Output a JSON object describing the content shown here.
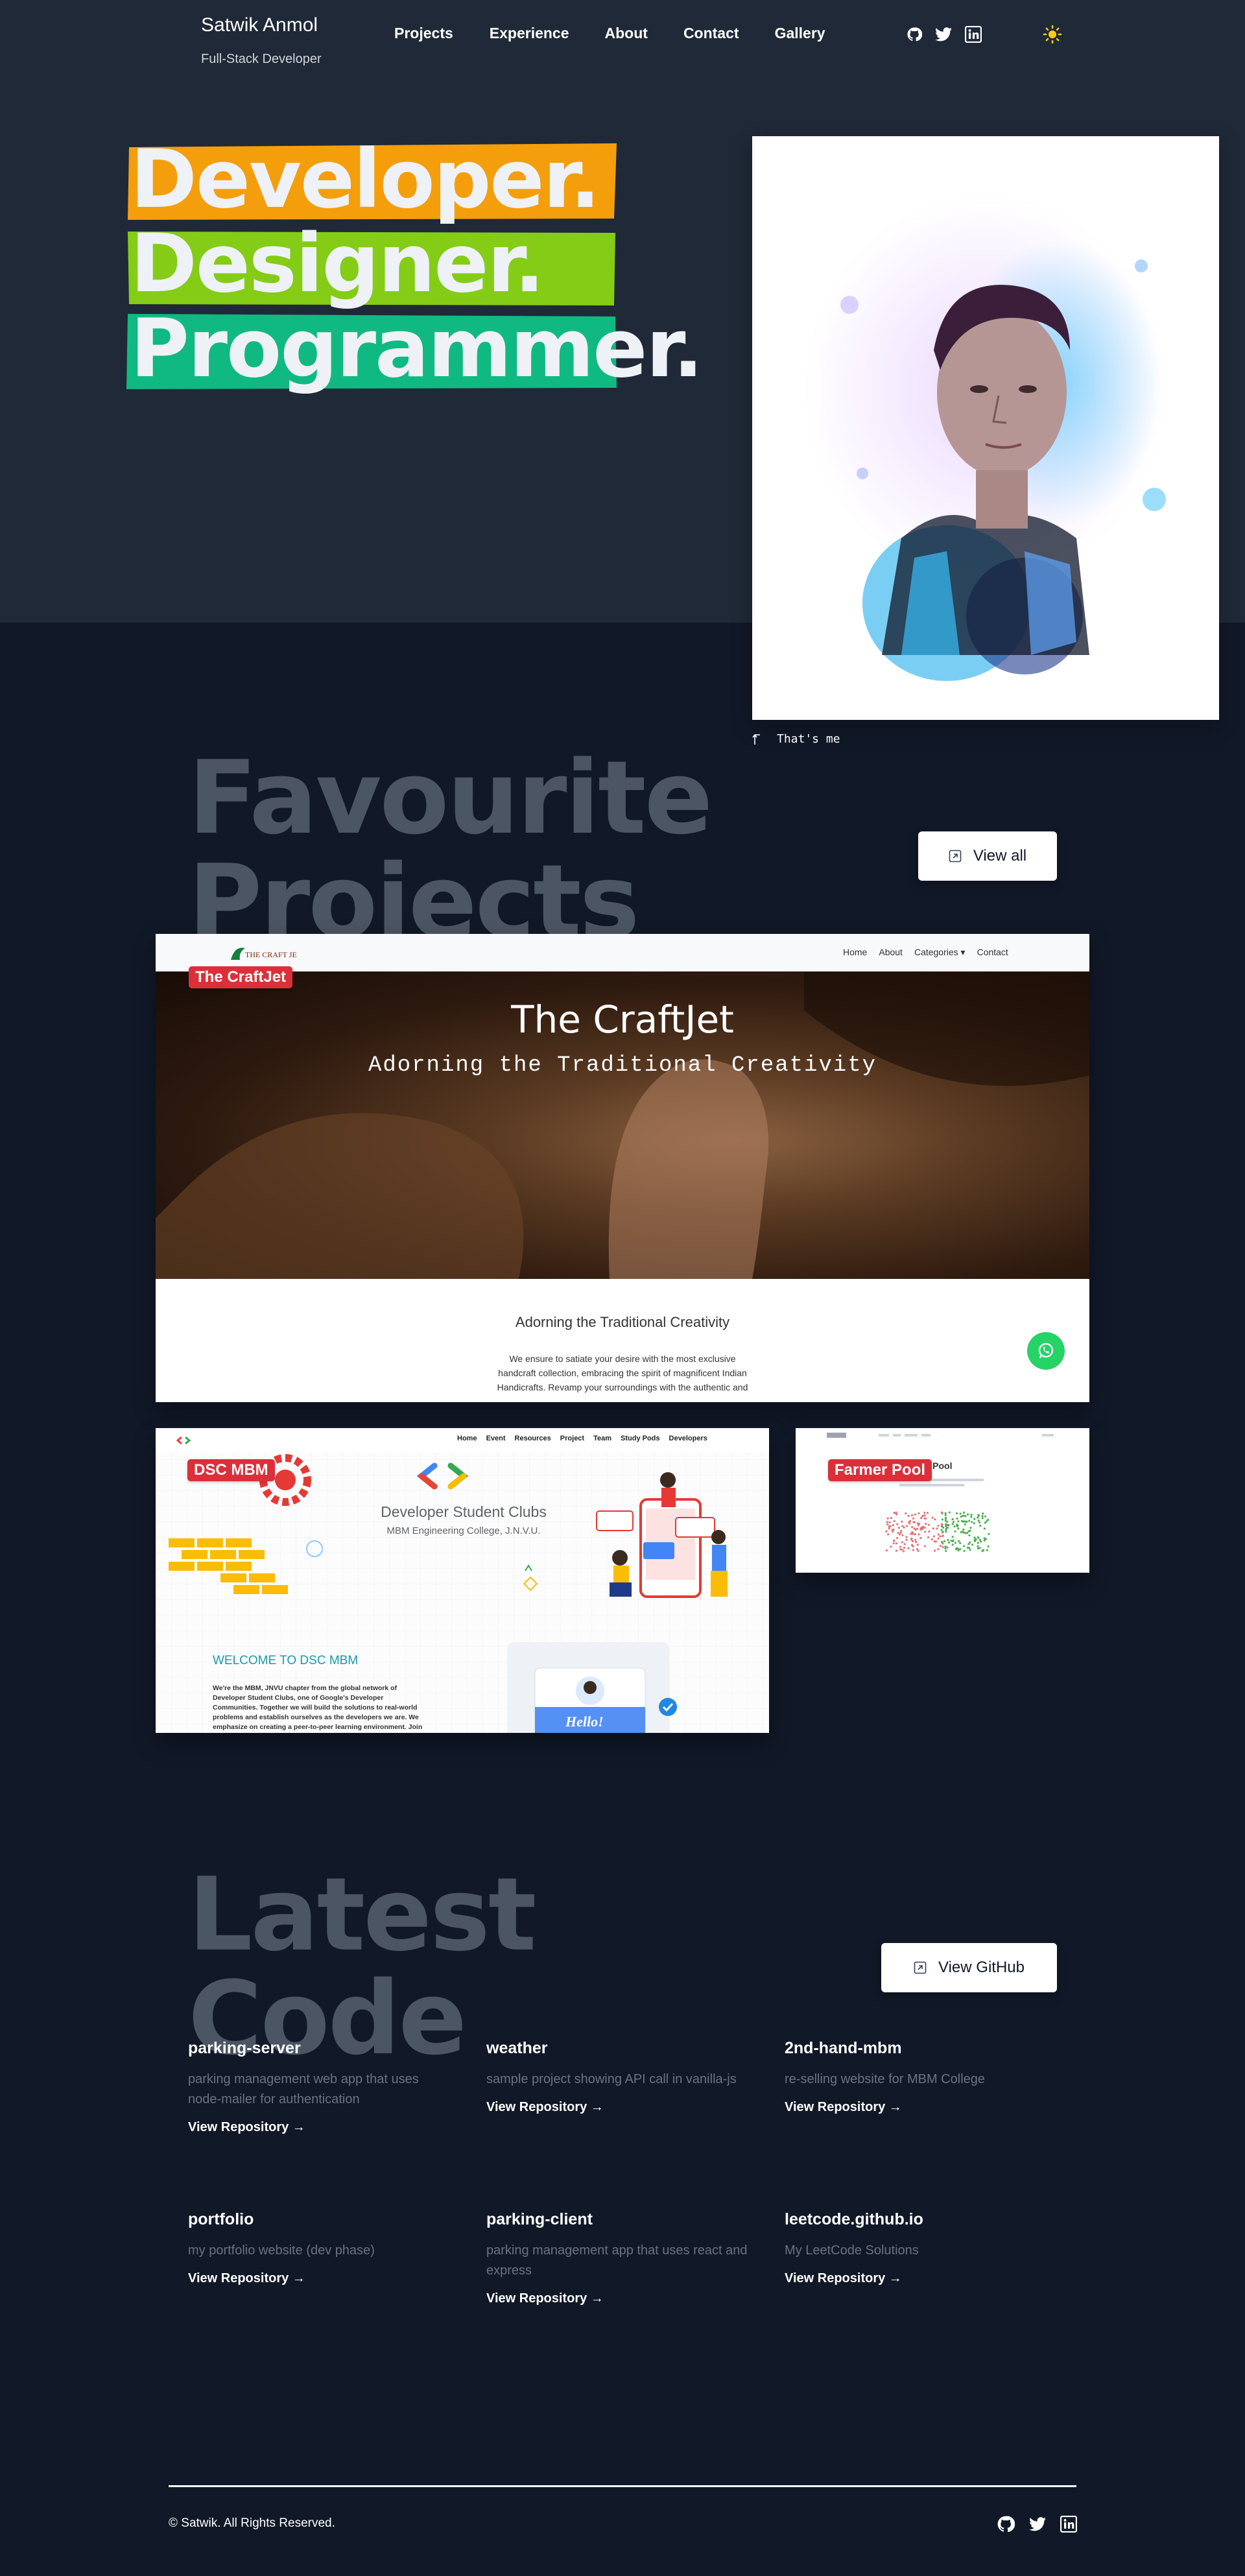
{
  "header": {
    "name": "Satwik Anmol",
    "role": "Full-Stack Developer",
    "nav": [
      "Projects",
      "Experience",
      "About",
      "Contact",
      "Gallery"
    ],
    "social_icons": [
      "github-icon",
      "twitter-icon",
      "linkedin-icon"
    ],
    "theme_icon": "sun-icon"
  },
  "hero": {
    "words": [
      "Developer.",
      "Designer.",
      "Programmer."
    ],
    "word_colors": [
      "#f59e0b",
      "#84cc16",
      "#10b981"
    ],
    "caption": "That's me"
  },
  "projects": {
    "title_line1": "Favourite",
    "title_line2": "Projects",
    "view_all_label": "View all",
    "craftjet": {
      "badge": "The CraftJet",
      "logo_text": "THE CRAFT JET",
      "nav": [
        "Home",
        "About",
        "Categories",
        "Contact"
      ],
      "hero_title": "The CraftJet",
      "hero_subtitle": "Adorning the Traditional Creativity",
      "section_heading": "Adorning the Traditional Creativity",
      "section_text_1": "We ensure to satiate your desire with the most exclusive",
      "section_text_2": "handcraft collection, embracing the spirit of magnificent Indian",
      "section_text_3": "Handicrafts. Revamp your surroundings with the authentic and"
    },
    "dsc": {
      "badge": "DSC MBM",
      "nav": [
        "Home",
        "Event",
        "Resources",
        "Project",
        "Team",
        "Study Pods",
        "Developers"
      ],
      "title": "Developer Student Clubs",
      "subtitle": "MBM Engineering College, J.N.V.U.",
      "welcome": "WELCOME TO DSC MBM",
      "para_1": "We're the MBM, JNVU chapter from the global network of",
      "para_2": "Developer Student Clubs, one of Google's Developer",
      "para_3": "Communities. Together we will build the solutions to real-world",
      "para_4": "problems and establish ourselves as the developers we are. We",
      "para_5": "emphasize on creating a peer-to-peer learning environment. Join",
      "hello": "Hello!"
    },
    "farmer": {
      "badge": "Farmer Pool",
      "heading_fragment": "er Pool"
    }
  },
  "code": {
    "title_line1": "Latest",
    "title_line2": "Code",
    "view_github_label": "View GitHub",
    "repos": [
      {
        "name": "parking-server",
        "desc": "parking management web app that uses node-mailer for authentication",
        "link": "View Repository →"
      },
      {
        "name": "weather",
        "desc": "sample project showing API call in vanilla-js",
        "link": "View Repository →"
      },
      {
        "name": "2nd-hand-mbm",
        "desc": "re-selling website for MBM College",
        "link": "View Repository →"
      },
      {
        "name": "portfolio",
        "desc": "my portfolio website (dev phase)",
        "link": "View Repository →"
      },
      {
        "name": "parking-client",
        "desc": "parking management app that uses react and express",
        "link": "View Repository →"
      },
      {
        "name": "leetcode.github.io",
        "desc": "My LeetCode Solutions",
        "link": "View Repository →"
      }
    ]
  },
  "footer": {
    "copyright": "© Satwik. All Rights Reserved.",
    "social_icons": [
      "github-icon",
      "twitter-icon",
      "linkedin-icon"
    ]
  }
}
